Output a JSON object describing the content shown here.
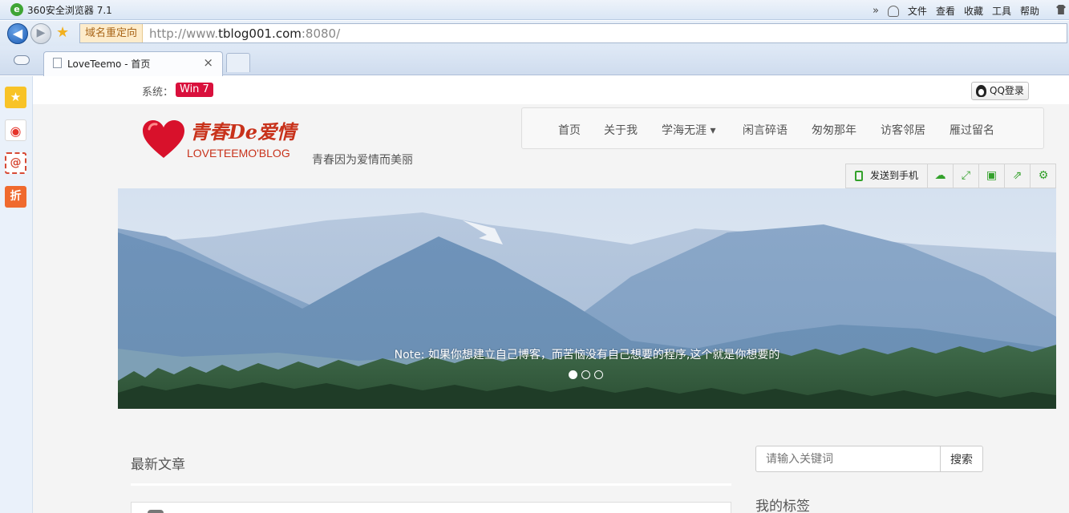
{
  "browser": {
    "app_title": "360安全浏览器 7.1",
    "menu": [
      "文件",
      "查看",
      "收藏",
      "工具",
      "帮助"
    ],
    "more": "»",
    "url_tag": "域名重定向",
    "url_prefix": "http://www.",
    "url_host": "tblog001.com",
    "url_suffix": ":8080/",
    "tab_title": "LoveTeemo - 首页",
    "tab_close": "×",
    "back": "◀",
    "forward": "▶",
    "star": "★"
  },
  "sidebar": {
    "fav": "★",
    "weibo": "◉",
    "mail": "@",
    "zhe": "折"
  },
  "page": {
    "system_label": "系统：",
    "system_value": "Win 7",
    "qq_login": "QQ登录",
    "logo_cn": "青春De爱情",
    "logo_en": "LOVETEEMO'BLOG",
    "slogan": "青春因为爱情而美丽",
    "nav": [
      "首页",
      "关于我",
      "学海无涯 ▾",
      "闲言碎语",
      "匆匆那年",
      "访客邻居",
      "雁过留名"
    ],
    "toolbar": {
      "send_to_phone": "发送到手机",
      "icons": [
        "☁",
        "⤢",
        "▣",
        "⇗",
        "⚙"
      ]
    },
    "banner": {
      "caption_note": "Note:",
      "caption_text": " 如果你想建立自己博客，而苦恼没有自己想要的程序,这个就是你想要的",
      "slides": 3,
      "active_slide": 1
    },
    "latest_title": "最新文章",
    "search_placeholder": "请输入关键词",
    "search_button": "搜索",
    "tags_title": "我的标签"
  },
  "colors": {
    "system_badge": "#d9103c",
    "logo_red": "#c8321b",
    "toolbar_green": "#33a12b"
  }
}
